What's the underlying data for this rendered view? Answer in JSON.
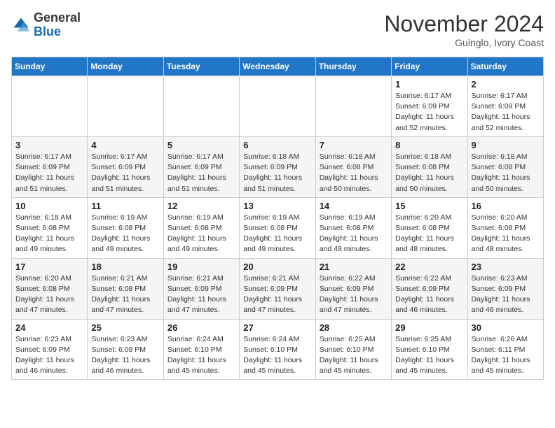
{
  "header": {
    "logo": {
      "line1": "General",
      "line2": "Blue"
    },
    "month_year": "November 2024",
    "location": "Guinglo, Ivory Coast"
  },
  "weekdays": [
    "Sunday",
    "Monday",
    "Tuesday",
    "Wednesday",
    "Thursday",
    "Friday",
    "Saturday"
  ],
  "weeks": [
    [
      {
        "day": "",
        "detail": ""
      },
      {
        "day": "",
        "detail": ""
      },
      {
        "day": "",
        "detail": ""
      },
      {
        "day": "",
        "detail": ""
      },
      {
        "day": "",
        "detail": ""
      },
      {
        "day": "1",
        "detail": "Sunrise: 6:17 AM\nSunset: 6:09 PM\nDaylight: 11 hours\nand 52 minutes."
      },
      {
        "day": "2",
        "detail": "Sunrise: 6:17 AM\nSunset: 6:09 PM\nDaylight: 11 hours\nand 52 minutes."
      }
    ],
    [
      {
        "day": "3",
        "detail": "Sunrise: 6:17 AM\nSunset: 6:09 PM\nDaylight: 11 hours\nand 51 minutes."
      },
      {
        "day": "4",
        "detail": "Sunrise: 6:17 AM\nSunset: 6:09 PM\nDaylight: 11 hours\nand 51 minutes."
      },
      {
        "day": "5",
        "detail": "Sunrise: 6:17 AM\nSunset: 6:09 PM\nDaylight: 11 hours\nand 51 minutes."
      },
      {
        "day": "6",
        "detail": "Sunrise: 6:18 AM\nSunset: 6:09 PM\nDaylight: 11 hours\nand 51 minutes."
      },
      {
        "day": "7",
        "detail": "Sunrise: 6:18 AM\nSunset: 6:08 PM\nDaylight: 11 hours\nand 50 minutes."
      },
      {
        "day": "8",
        "detail": "Sunrise: 6:18 AM\nSunset: 6:08 PM\nDaylight: 11 hours\nand 50 minutes."
      },
      {
        "day": "9",
        "detail": "Sunrise: 6:18 AM\nSunset: 6:08 PM\nDaylight: 11 hours\nand 50 minutes."
      }
    ],
    [
      {
        "day": "10",
        "detail": "Sunrise: 6:18 AM\nSunset: 6:08 PM\nDaylight: 11 hours\nand 49 minutes."
      },
      {
        "day": "11",
        "detail": "Sunrise: 6:19 AM\nSunset: 6:08 PM\nDaylight: 11 hours\nand 49 minutes."
      },
      {
        "day": "12",
        "detail": "Sunrise: 6:19 AM\nSunset: 6:08 PM\nDaylight: 11 hours\nand 49 minutes."
      },
      {
        "day": "13",
        "detail": "Sunrise: 6:19 AM\nSunset: 6:08 PM\nDaylight: 11 hours\nand 49 minutes."
      },
      {
        "day": "14",
        "detail": "Sunrise: 6:19 AM\nSunset: 6:08 PM\nDaylight: 11 hours\nand 48 minutes."
      },
      {
        "day": "15",
        "detail": "Sunrise: 6:20 AM\nSunset: 6:08 PM\nDaylight: 11 hours\nand 48 minutes."
      },
      {
        "day": "16",
        "detail": "Sunrise: 6:20 AM\nSunset: 6:08 PM\nDaylight: 11 hours\nand 48 minutes."
      }
    ],
    [
      {
        "day": "17",
        "detail": "Sunrise: 6:20 AM\nSunset: 6:08 PM\nDaylight: 11 hours\nand 47 minutes."
      },
      {
        "day": "18",
        "detail": "Sunrise: 6:21 AM\nSunset: 6:08 PM\nDaylight: 11 hours\nand 47 minutes."
      },
      {
        "day": "19",
        "detail": "Sunrise: 6:21 AM\nSunset: 6:09 PM\nDaylight: 11 hours\nand 47 minutes."
      },
      {
        "day": "20",
        "detail": "Sunrise: 6:21 AM\nSunset: 6:09 PM\nDaylight: 11 hours\nand 47 minutes."
      },
      {
        "day": "21",
        "detail": "Sunrise: 6:22 AM\nSunset: 6:09 PM\nDaylight: 11 hours\nand 47 minutes."
      },
      {
        "day": "22",
        "detail": "Sunrise: 6:22 AM\nSunset: 6:09 PM\nDaylight: 11 hours\nand 46 minutes."
      },
      {
        "day": "23",
        "detail": "Sunrise: 6:23 AM\nSunset: 6:09 PM\nDaylight: 11 hours\nand 46 minutes."
      }
    ],
    [
      {
        "day": "24",
        "detail": "Sunrise: 6:23 AM\nSunset: 6:09 PM\nDaylight: 11 hours\nand 46 minutes."
      },
      {
        "day": "25",
        "detail": "Sunrise: 6:23 AM\nSunset: 6:09 PM\nDaylight: 11 hours\nand 46 minutes."
      },
      {
        "day": "26",
        "detail": "Sunrise: 6:24 AM\nSunset: 6:10 PM\nDaylight: 11 hours\nand 45 minutes."
      },
      {
        "day": "27",
        "detail": "Sunrise: 6:24 AM\nSunset: 6:10 PM\nDaylight: 11 hours\nand 45 minutes."
      },
      {
        "day": "28",
        "detail": "Sunrise: 6:25 AM\nSunset: 6:10 PM\nDaylight: 11 hours\nand 45 minutes."
      },
      {
        "day": "29",
        "detail": "Sunrise: 6:25 AM\nSunset: 6:10 PM\nDaylight: 11 hours\nand 45 minutes."
      },
      {
        "day": "30",
        "detail": "Sunrise: 6:26 AM\nSunset: 6:11 PM\nDaylight: 11 hours\nand 45 minutes."
      }
    ]
  ]
}
